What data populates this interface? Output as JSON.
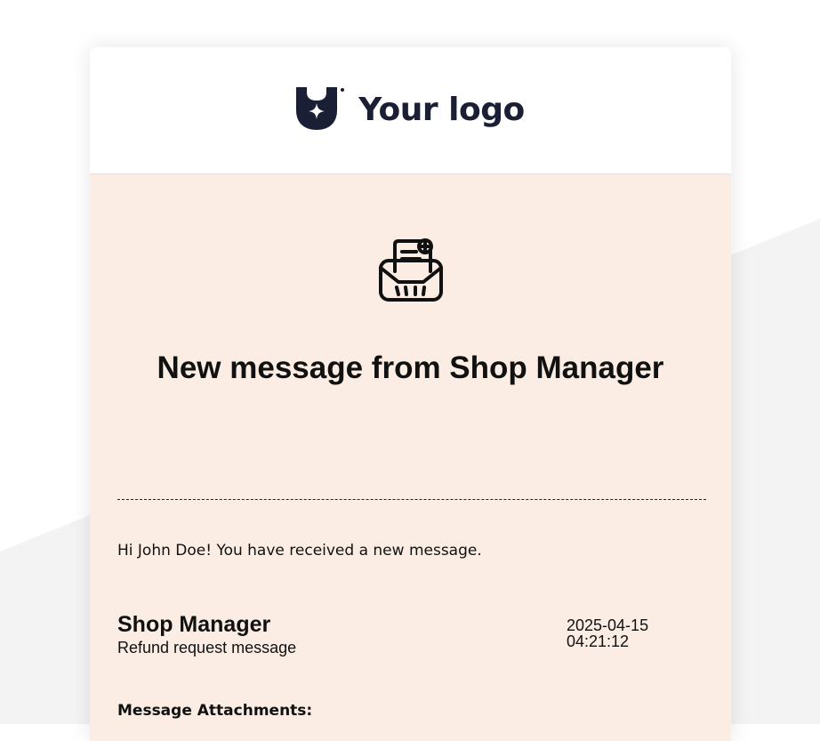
{
  "colors": {
    "body_background": "#fbede3",
    "header_background": "#ffffff",
    "logo_color": "#1b1f36",
    "text": "#111111",
    "page_background_shape": "#f3f3f3"
  },
  "header": {
    "logo_icon": "shield-star-icon",
    "logo_text": "Your logo"
  },
  "message": {
    "icon": "envelope-letter-icon",
    "headline": "New message from Shop Manager",
    "greeting": "Hi John Doe! You have received a new message.",
    "sender_name": "Shop Manager",
    "subject": "Refund request message",
    "date": "2025-04-15",
    "time": "04:21:12",
    "attachments_label": "Message Attachments:"
  }
}
